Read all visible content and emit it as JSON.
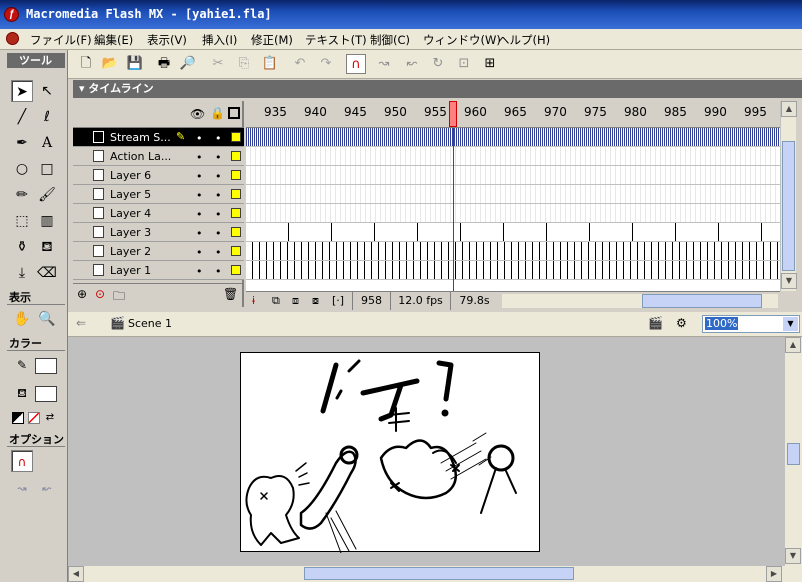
{
  "window": {
    "title": "Macromedia Flash MX - [yahie1.fla]",
    "app_icon": "flash-icon"
  },
  "menu": [
    "ファイル(F)",
    "編集(E)",
    "表示(V)",
    "挿入(I)",
    "修正(M)",
    "テキスト(T)",
    "制御(C)",
    "ウィンドウ(W)",
    "ヘルプ(H)"
  ],
  "tools": {
    "title": "ツール",
    "view_label": "表示",
    "color_label": "カラー",
    "option_label": "オプション"
  },
  "timeline": {
    "title": "タイムライン",
    "frame_numbers": [
      "935",
      "940",
      "945",
      "950",
      "955",
      "960",
      "965",
      "970",
      "975",
      "980",
      "985",
      "990",
      "995"
    ],
    "layers": [
      {
        "name": "Stream S...",
        "selected": true
      },
      {
        "name": "Action La...",
        "selected": false
      },
      {
        "name": "Layer 6",
        "selected": false
      },
      {
        "name": "Layer 5",
        "selected": false
      },
      {
        "name": "Layer 4",
        "selected": false
      },
      {
        "name": "Layer 3",
        "selected": false
      },
      {
        "name": "Layer 2",
        "selected": false
      },
      {
        "name": "Layer 1",
        "selected": false
      }
    ],
    "current_frame": "958",
    "frame_rate": "12.0 fps",
    "elapsed": "79.8s"
  },
  "scene": {
    "name": "Scene 1",
    "zoom": "100%"
  },
  "colors": {
    "title_bar": "#0a246a",
    "playhead": "#ff0000",
    "layer_color": "#ffff00"
  }
}
